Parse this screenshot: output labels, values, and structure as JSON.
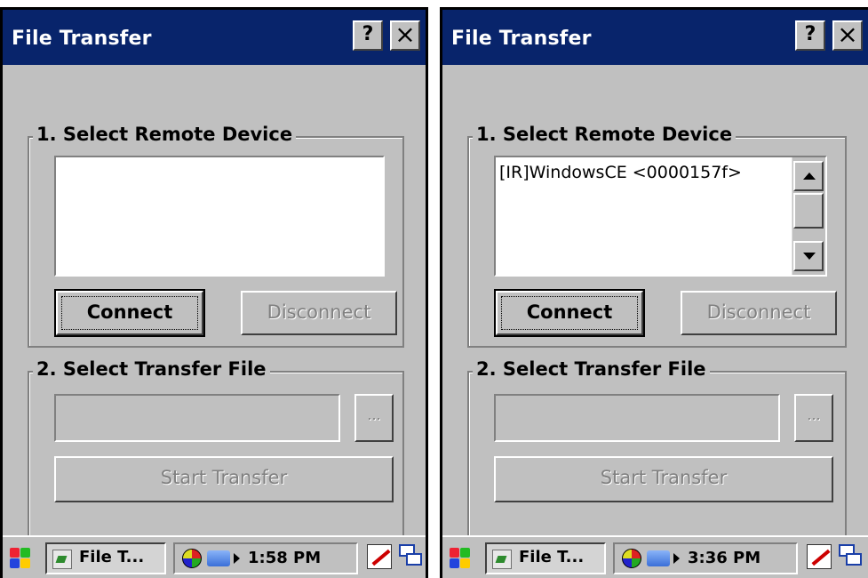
{
  "screens": [
    {
      "window": {
        "title": "File Transfer",
        "help_label": "?",
        "close_label": "×"
      },
      "group1": {
        "legend": "1. Select Remote Device",
        "items": []
      },
      "connect_label": "Connect",
      "disconnect_label": "Disconnect",
      "group2": {
        "legend": "2. Select Transfer File",
        "file_value": "",
        "browse_label": "...",
        "start_label": "Start Transfer"
      },
      "taskbar": {
        "task_label": "File T...",
        "clock": "1:58 PM"
      }
    },
    {
      "window": {
        "title": "File Transfer",
        "help_label": "?",
        "close_label": "×"
      },
      "group1": {
        "legend": "1. Select Remote Device",
        "items": [
          "[IR]WindowsCE <0000157f>"
        ]
      },
      "connect_label": "Connect",
      "disconnect_label": "Disconnect",
      "group2": {
        "legend": "2. Select Transfer File",
        "file_value": "",
        "browse_label": "...",
        "start_label": "Start Transfer"
      },
      "taskbar": {
        "task_label": "File T...",
        "clock": "3:36 PM"
      }
    }
  ],
  "colors": {
    "titlebar": "#08246b",
    "dialog_bg": "#c0c0c0",
    "disabled_text": "#808080"
  },
  "icons": [
    "windows-start-icon",
    "file-transfer-app-icon",
    "globe-icon",
    "network-icon",
    "tray-expand-icon",
    "input-panel-icon",
    "switch-windows-icon"
  ]
}
